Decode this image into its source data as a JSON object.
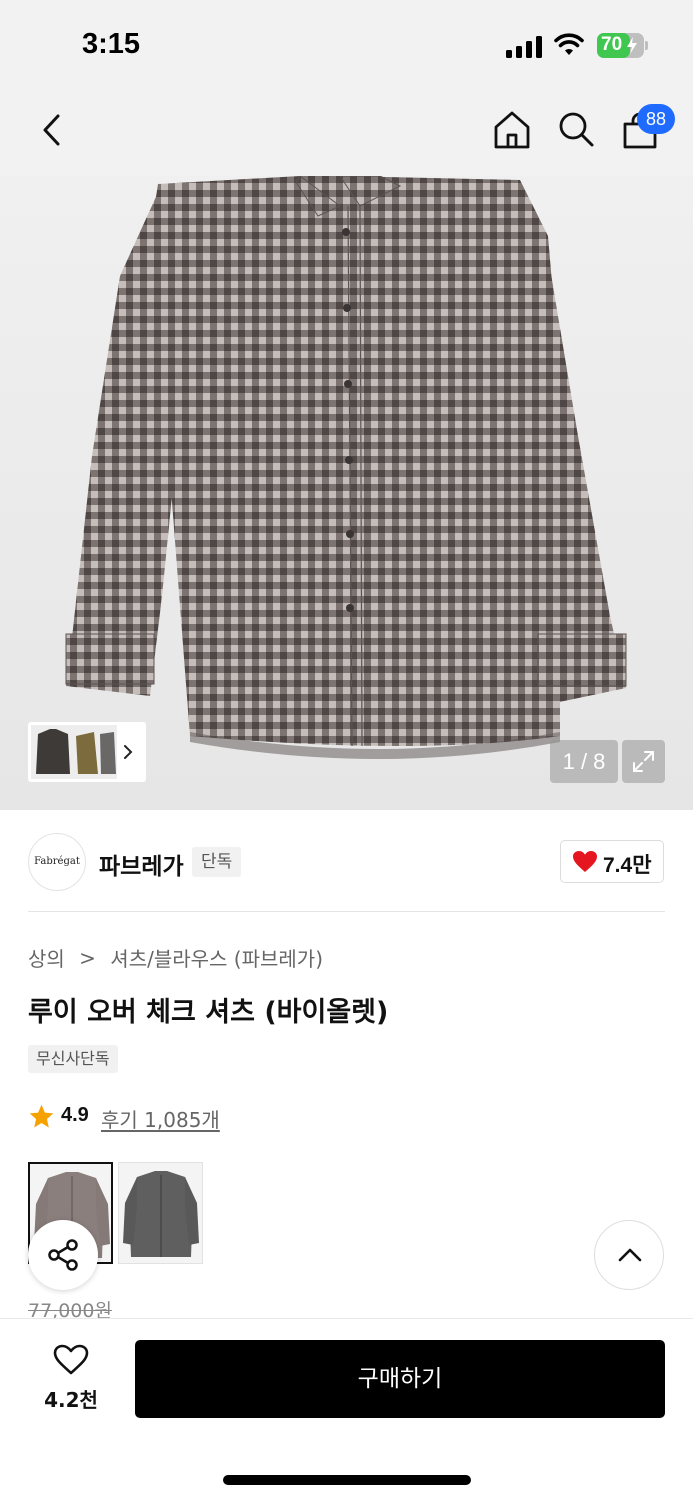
{
  "status_bar": {
    "time": "3:15",
    "battery": "70",
    "battery_level": 0.7,
    "icons": [
      "signal-icon",
      "wifi-icon",
      "battery-icon"
    ]
  },
  "nav": {
    "back_icon": "chevron-left-icon",
    "home_icon": "home-icon",
    "search_icon": "search-icon",
    "cart_icon": "shopping-bag-icon",
    "cart_count": "88"
  },
  "gallery": {
    "counter": "1 / 8",
    "expand_icon": "expand-icon",
    "thumb_next_icon": "chevron-right-icon",
    "image": "gray-check-shirt-image"
  },
  "brand": {
    "logo_text": "Fabrégat",
    "name": "파브레가",
    "tag": "단독",
    "like_icon": "heart-icon",
    "like_count": "7.4만",
    "like_color": "#e5161f"
  },
  "breadcrumb": {
    "category": "상의",
    "separator": ">",
    "subcategory": "셔츠/블라우스 (파브레가)"
  },
  "product": {
    "title": "루이 오버 체크 셔츠 (바이올렛)",
    "tag": "무신사단독",
    "rating": "4.9",
    "rating_icon": "star-icon",
    "star_color": "#f5a100",
    "review_text": "후기 1,085개",
    "original_price": "77,000원"
  },
  "color_options": [
    {
      "name": "violet-check",
      "selected": true
    },
    {
      "name": "gray-check",
      "selected": false
    }
  ],
  "floating": {
    "share_icon": "share-icon",
    "top_icon": "chevron-up-icon"
  },
  "bottom_bar": {
    "wish_icon": "heart-outline-icon",
    "wish_count": "4.2천",
    "buy_label": "구매하기",
    "buy_color": "#000000"
  }
}
